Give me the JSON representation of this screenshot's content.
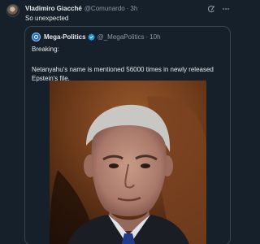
{
  "tweet": {
    "author_name": "Vladimiro Giacché",
    "author_handle": "@Comunardo",
    "separator": "·",
    "time": "3h",
    "text": "So unexpected"
  },
  "quoted_tweet": {
    "author_name": "Mega-Politics",
    "author_handle": "@_MegaPolitics",
    "separator": "·",
    "time": "10h",
    "line1": "Breaking:",
    "line2": "Netanyahu's name is mentioned 56000 times in newly released",
    "line3": "Epstein's file."
  },
  "icons": {
    "header_actions": [
      "grok-icon",
      "more-icon"
    ],
    "verified": "verified-badge-icon"
  },
  "colors": {
    "background": "#15202b",
    "text_primary": "#e7e9ea",
    "text_secondary": "#8b98a5",
    "border": "#38444d",
    "verified_badge": "#1d9bf0"
  }
}
